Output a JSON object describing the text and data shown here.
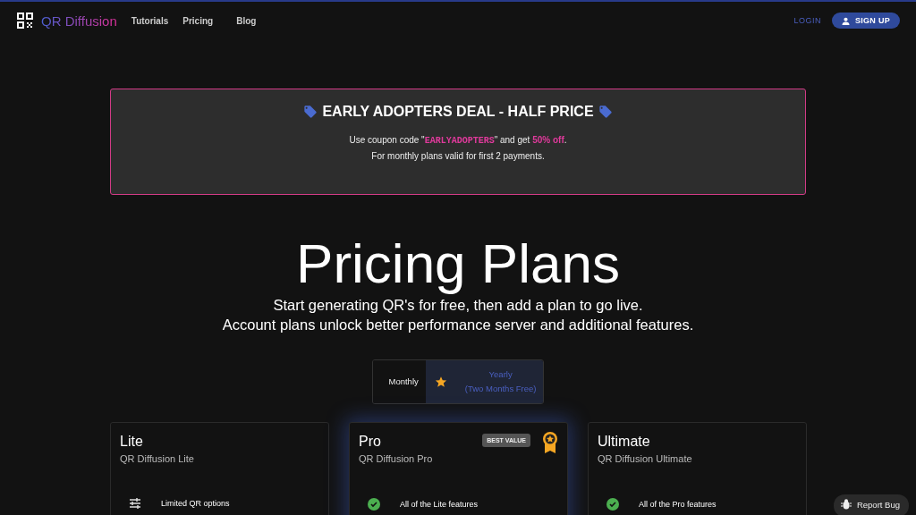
{
  "nav": {
    "brand": "QR Diffusion",
    "links": [
      "Tutorials",
      "Pricing",
      "Blog"
    ],
    "login": "LOGIN",
    "signup": "SIGN UP"
  },
  "banner": {
    "title": "EARLY ADOPTERS DEAL - HALF PRICE",
    "lines": [
      "Use coupon code \"**EARLYADOPTERS**\" and get **50% off**.",
      "For monthly plans valid for first 2 payments."
    ]
  },
  "hero": {
    "title": "Pricing Plans",
    "subtitle": [
      "Start generating QR's for free, then add a plan to go live.",
      "Account plans unlock better performance server and additional features."
    ]
  },
  "billing": [
    {
      "label": "Monthly",
      "selected": false
    },
    {
      "label": "Yearly",
      "note": "(Two Months Free)",
      "selected": true
    }
  ],
  "plans": [
    {
      "name": "Lite",
      "subtitle": "QR Diffusion Lite",
      "highlighted": false,
      "features": [
        {
          "kind": "sliders",
          "text": "Limited QR options"
        }
      ]
    },
    {
      "name": "Pro",
      "subtitle": "QR Diffusion Pro",
      "highlighted": true,
      "badge": "BEST VALUE",
      "features": [
        {
          "kind": "check",
          "text": "All of the Lite features"
        }
      ]
    },
    {
      "name": "Ultimate",
      "subtitle": "QR Diffusion Ultimate",
      "highlighted": false,
      "features": [
        {
          "kind": "check",
          "text": "All of the Pro features"
        }
      ]
    }
  ],
  "report_bug": "Report Bug"
}
